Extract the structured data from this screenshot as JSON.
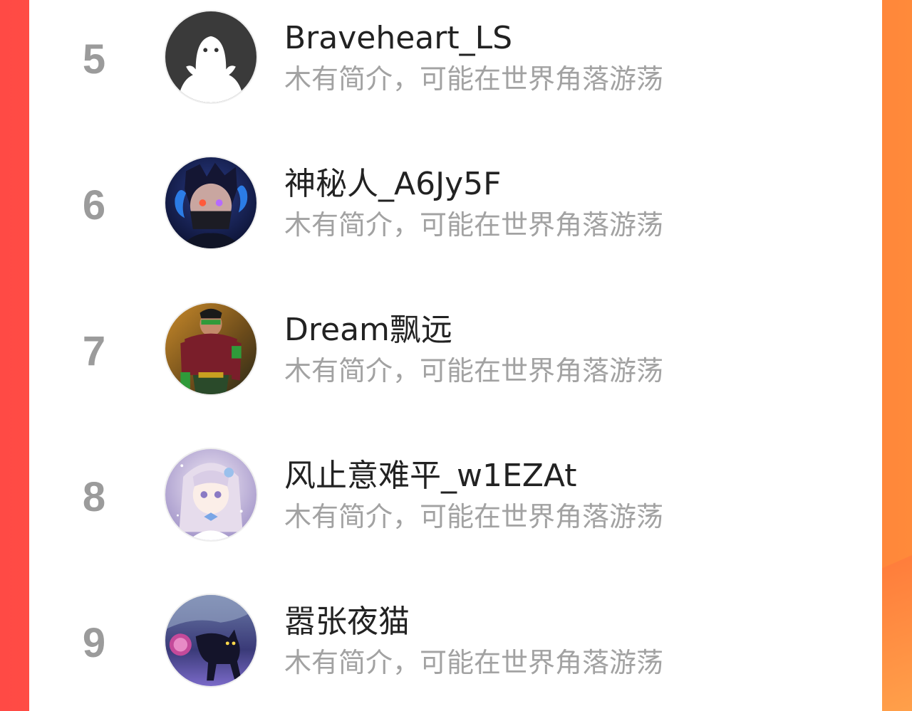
{
  "ranking": {
    "rows": [
      {
        "rank": "5",
        "name": "Braveheart_LS",
        "bio": "木有简介，可能在世界角落游荡",
        "avatar_icon": "default-ghost-avatar"
      },
      {
        "rank": "6",
        "name": "神秘人_A6Jy5F",
        "bio": "木有简介，可能在世界角落游荡",
        "avatar_icon": "anime-masked-boy-avatar"
      },
      {
        "rank": "7",
        "name": "Dream飘远",
        "bio": "木有简介，可能在世界角落游荡",
        "avatar_icon": "superhero-avatar"
      },
      {
        "rank": "8",
        "name": "风止意难平_w1EZAt",
        "bio": "木有简介，可能在世界角落游荡",
        "avatar_icon": "anime-girl-avatar"
      },
      {
        "rank": "9",
        "name": "嚣张夜猫",
        "bio": "木有简介，可能在世界角落游荡",
        "avatar_icon": "black-cat-avatar"
      }
    ]
  },
  "colors": {
    "background_gradient_start": "#ff4a45",
    "background_gradient_end": "#ff8a3a",
    "panel": "#ffffff",
    "rank_text": "#9b9b9b",
    "name_text": "#222222",
    "bio_text": "#a2a2a2"
  }
}
